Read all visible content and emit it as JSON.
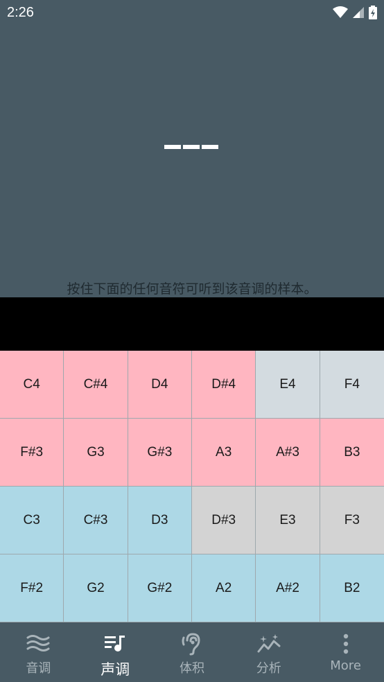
{
  "status_bar": {
    "time": "2:26"
  },
  "display": {
    "note": "---",
    "hint": "按住下面的任何音符可听到该音调的样本。"
  },
  "keyboard": {
    "rows": [
      [
        {
          "label": "C4",
          "color": "pink"
        },
        {
          "label": "C#4",
          "color": "pink"
        },
        {
          "label": "D4",
          "color": "pink"
        },
        {
          "label": "D#4",
          "color": "pink"
        },
        {
          "label": "E4",
          "color": "grey"
        },
        {
          "label": "F4",
          "color": "grey"
        }
      ],
      [
        {
          "label": "F#3",
          "color": "pink"
        },
        {
          "label": "G3",
          "color": "pink"
        },
        {
          "label": "G#3",
          "color": "pink"
        },
        {
          "label": "A3",
          "color": "pink"
        },
        {
          "label": "A#3",
          "color": "pink"
        },
        {
          "label": "B3",
          "color": "pink"
        }
      ],
      [
        {
          "label": "C3",
          "color": "blue"
        },
        {
          "label": "C#3",
          "color": "blue"
        },
        {
          "label": "D3",
          "color": "blue"
        },
        {
          "label": "D#3",
          "color": "lightgrey"
        },
        {
          "label": "E3",
          "color": "lightgrey"
        },
        {
          "label": "F3",
          "color": "lightgrey"
        }
      ],
      [
        {
          "label": "F#2",
          "color": "blue"
        },
        {
          "label": "G2",
          "color": "blue"
        },
        {
          "label": "G#2",
          "color": "blue"
        },
        {
          "label": "A2",
          "color": "blue"
        },
        {
          "label": "A#2",
          "color": "blue"
        },
        {
          "label": "B2",
          "color": "blue"
        }
      ]
    ]
  },
  "bottom_nav": {
    "items": [
      {
        "label": "音调",
        "icon": "waves-icon",
        "active": false
      },
      {
        "label": "声调",
        "icon": "music-note-list-icon",
        "active": true
      },
      {
        "label": "体积",
        "icon": "ear-icon",
        "active": false
      },
      {
        "label": "分析",
        "icon": "sparkle-chart-icon",
        "active": false
      },
      {
        "label": "More",
        "icon": "more-vertical-icon",
        "active": false
      }
    ]
  },
  "colors": {
    "background": "#485a64",
    "pink": "#ffb6c1",
    "blue": "#add8e6",
    "grey": "#d3dbe0",
    "lightgrey": "#d3d3d3"
  }
}
